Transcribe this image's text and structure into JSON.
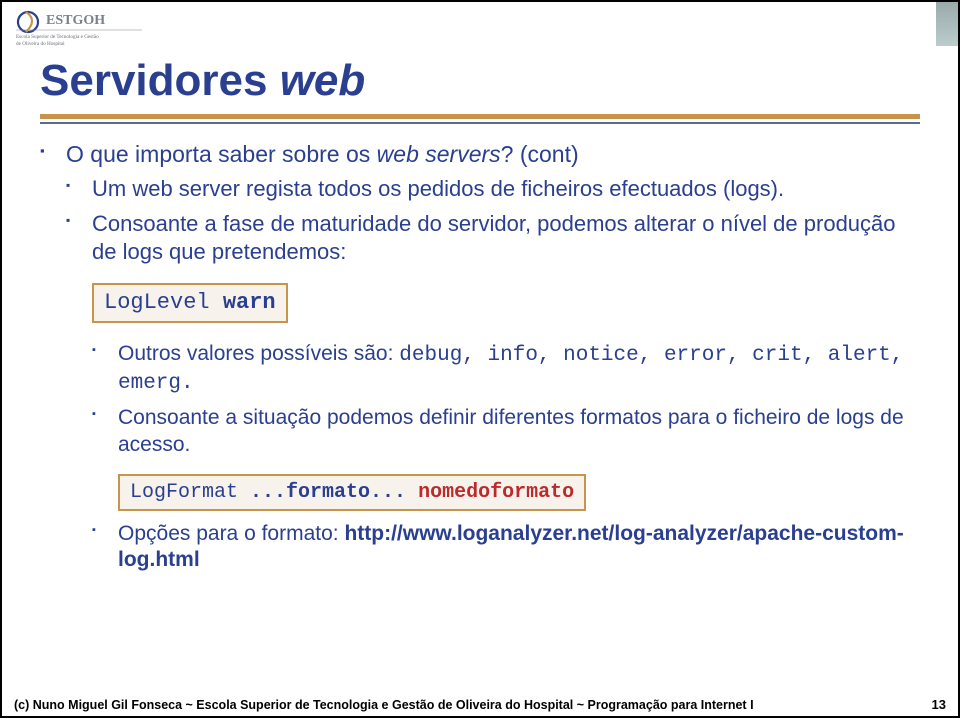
{
  "logo": {
    "name": "ESTGOH",
    "subtitle": "Escola Superior de Tecnologia e Gestão de Oliveira do Hospital"
  },
  "title_plain": "Servidores ",
  "title_ital": "web",
  "bullets": {
    "b1_pre": "O que importa saber sobre os ",
    "b1_ital": "web servers",
    "b1_post": "? (cont)",
    "b2_pre": "Um ",
    "b2_ital1": "web server",
    "b2_mid": " regista todos os pedidos de ficheiros efectuados ",
    "b2_ital2": "(logs)",
    "b2_post": ".",
    "b3": "Consoante a fase de maturidade do servidor, podemos alterar o nível de produção de logs que pretendemos:",
    "code1_a": "LogLevel ",
    "code1_b": "warn",
    "b4_pre": "Outros valores possíveis são: ",
    "b4_vals": "debug, info, notice, error, crit, alert, emerg.",
    "b5_pre": "Consoante a situação podemos definir diferentes formatos para o ficheiro de ",
    "b5_ital": "logs",
    "b5_post": " de acesso.",
    "code2_a": "LogFormat ",
    "code2_b": "...formato...",
    "code2_c": " nomedoformato",
    "b6_pre": "Opções para o formato: ",
    "b6_link": "http://www.loganalyzer.net/log-analyzer/apache-custom-log.html"
  },
  "footer": {
    "left": "(c) Nuno Miguel Gil Fonseca  ~  Escola Superior de Tecnologia e Gestão de Oliveira do Hospital  ~  Programação para Internet I",
    "page": "13"
  }
}
